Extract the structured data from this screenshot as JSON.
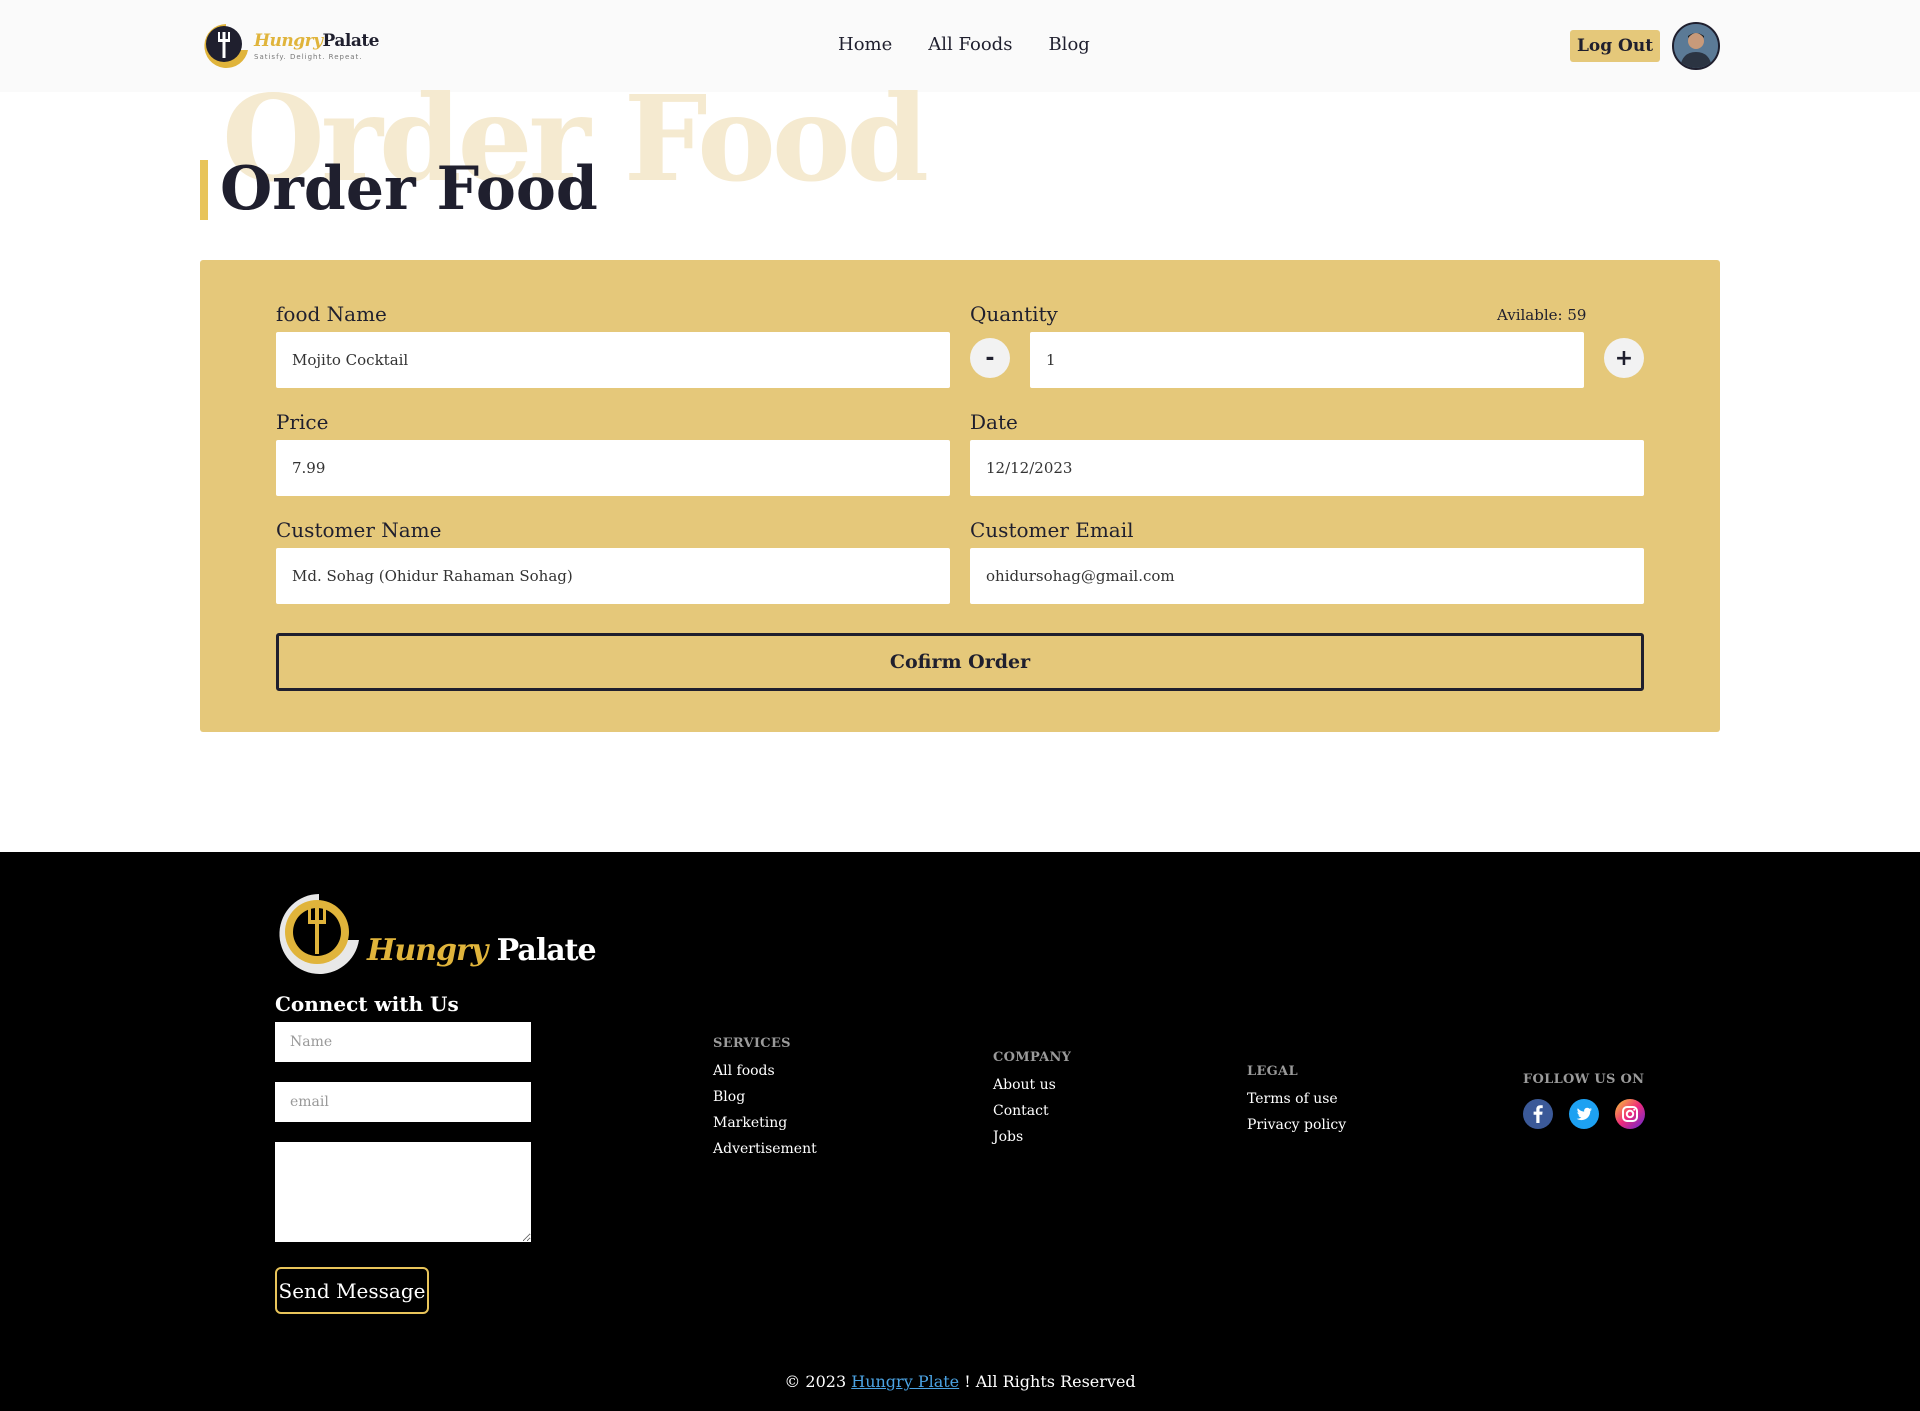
{
  "header": {
    "logo": {
      "word1": "Hungry",
      "word2": "Palate",
      "tagline": "Satisfy. Delight. Repeat."
    },
    "nav": [
      {
        "label": "Home"
      },
      {
        "label": "All Foods"
      },
      {
        "label": "Blog"
      }
    ],
    "logout_label": "Log Out"
  },
  "page": {
    "ghost_title": "Order Food",
    "title": "Order Food"
  },
  "form": {
    "food_name": {
      "label": "food Name",
      "value": "Mojito Cocktail"
    },
    "quantity": {
      "label": "Quantity",
      "available": "Avilable: 59",
      "value": "1",
      "minus": "-",
      "plus": "+"
    },
    "price": {
      "label": "Price",
      "value": "7.99"
    },
    "date": {
      "label": "Date",
      "value": "12/12/2023"
    },
    "customer_name": {
      "label": "Customer Name",
      "value": "Md. Sohag (Ohidur Rahaman Sohag)"
    },
    "customer_email": {
      "label": "Customer Email",
      "value": "ohidursohag@gmail.com"
    },
    "submit_label": "Cofirm Order"
  },
  "footer": {
    "logo": {
      "word1": "Hungry",
      "word2": "Palate"
    },
    "connect_title": "Connect with Us",
    "name_placeholder": "Name",
    "email_placeholder": "email",
    "send_label": "Send Message",
    "services": {
      "title": "SERVICES",
      "links": [
        "All foods",
        "Blog",
        "Marketing",
        "Advertisement"
      ]
    },
    "company": {
      "title": "COMPANY",
      "links": [
        "About us",
        "Contact",
        "Jobs"
      ]
    },
    "legal": {
      "title": "LEGAL",
      "links": [
        "Terms of use",
        "Privacy policy"
      ]
    },
    "follow": {
      "title": "FOLLOW US ON",
      "icons": [
        "facebook-icon",
        "twitter-icon",
        "instagram-icon"
      ]
    },
    "copyright": {
      "prefix": "© 2023",
      "brand": "Hungry Plate",
      "suffix": "! All Rights Reserved"
    }
  },
  "colors": {
    "accent": "#e5c87a",
    "title_bar": "#e8c45a",
    "ghost": "#f5ead0",
    "dark": "#1f1f2e",
    "footer_bg": "#000000",
    "link_blue": "#4ba3e3"
  }
}
